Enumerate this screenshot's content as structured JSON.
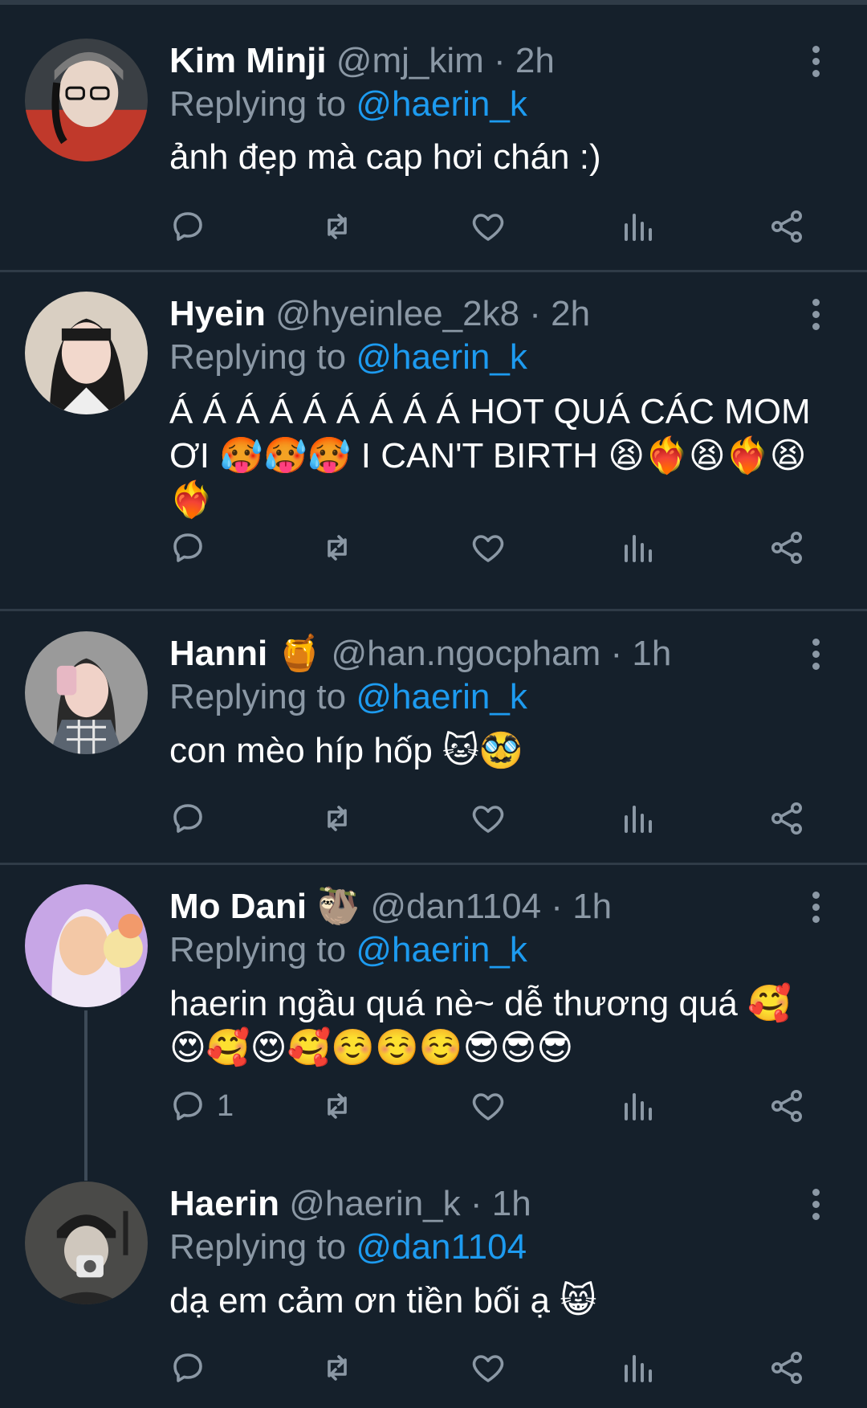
{
  "tweets": [
    {
      "name": "Kim Minji",
      "handle": "@mj_kim",
      "time": "2h",
      "replying_label": "Replying to",
      "replying_to": "@haerin_k",
      "text": "ảnh đẹp mà cap hơi chán :)",
      "reply_count": "",
      "avatar_colors": [
        "#c0392b",
        "#7a7a7a",
        "#e8d5c8"
      ]
    },
    {
      "name": "Hyein",
      "handle": "@hyeinlee_2k8",
      "time": "2h",
      "replying_label": "Replying to",
      "replying_to": "@haerin_k",
      "text_line1": "Á Á Á Á Á Á Á Á Á HOT QUÁ CÁC MOM",
      "text_line2_a": "ƠI",
      "text_line2_emojis_a": "🥵🥵🥵",
      "text_line2_b": " I CAN'T BIRTH ",
      "text_line2_emojis_b": "😫❤️‍🔥😫❤️‍🔥😫",
      "text_line3_emojis": "❤️‍🔥",
      "reply_count": "",
      "avatar_colors": [
        "#d9cfc2",
        "#1b1b1b",
        "#f2d8cc"
      ]
    },
    {
      "name": "Hanni",
      "name_emoji": "🍯",
      "handle": "@han.ngocpham",
      "time": "1h",
      "replying_label": "Replying to",
      "replying_to": "@haerin_k",
      "text": "con mèo híp hốp ",
      "text_emojis": "🐱🥸",
      "reply_count": "",
      "avatar_colors": [
        "#9a9a9a",
        "#2a2a2a",
        "#f0d2c8"
      ]
    },
    {
      "name": "Mo Dani",
      "name_emoji": "🦥",
      "handle": "@dan1104",
      "time": "1h",
      "replying_label": "Replying to",
      "replying_to": "@haerin_k",
      "text_line1": "haerin ngầu quá nè~ dễ thương quá ",
      "text_line1_emoji": "🥰",
      "text_line2_emojis": "😍🥰😍🥰☺️☺️☺️😎😎😎",
      "reply_count": "1",
      "avatar_colors": [
        "#c7a6e6",
        "#f3c8a6",
        "#f5e3a0"
      ]
    },
    {
      "name": "Haerin",
      "handle": "@haerin_k",
      "time": "1h",
      "replying_label": "Replying to",
      "replying_to": "@dan1104",
      "text": "dạ em cảm ơn tiền bối ạ ",
      "text_emojis": "😸",
      "reply_count": "",
      "avatar_colors": [
        "#4a4a48",
        "#1c1c1c",
        "#cfc7bd"
      ]
    }
  ],
  "icons": [
    "reply-icon",
    "retweet-icon",
    "like-icon",
    "views-icon",
    "share-icon",
    "more-icon"
  ],
  "colors": {
    "background": "#15202b",
    "divider": "#2f3b47",
    "secondary_text": "#8b98a5",
    "mention": "#1d9bf0"
  }
}
